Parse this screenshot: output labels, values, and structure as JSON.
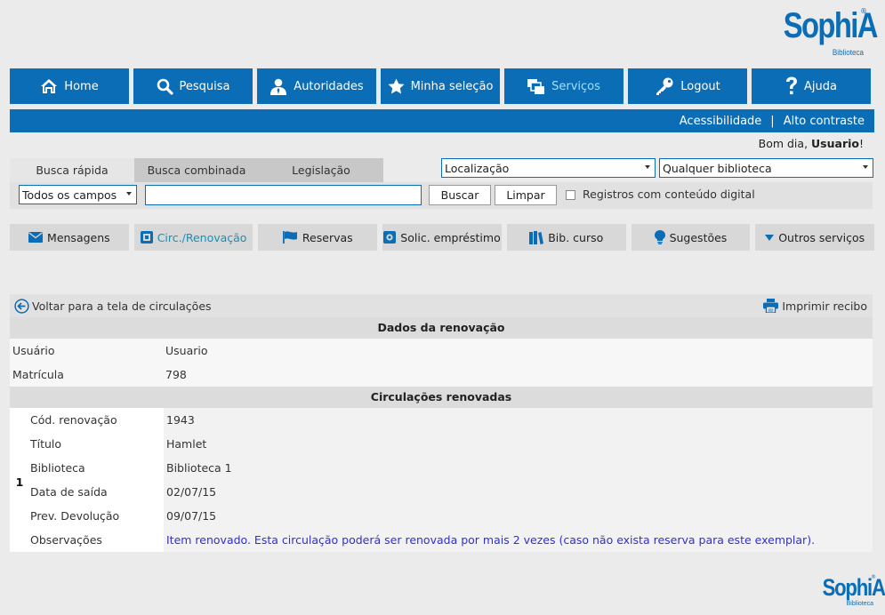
{
  "logo": {
    "word": "SophiA",
    "reg": "®",
    "sub": "Biblioteca"
  },
  "nav": [
    {
      "label": "Home",
      "icon": "home-icon"
    },
    {
      "label": "Pesquisa",
      "icon": "search-icon"
    },
    {
      "label": "Autoridades",
      "icon": "user-icon"
    },
    {
      "label": "Minha seleção",
      "icon": "star-icon"
    },
    {
      "label": "Serviços",
      "icon": "services-icon",
      "active": true
    },
    {
      "label": "Logout",
      "icon": "key-icon"
    },
    {
      "label": "Ajuda",
      "icon": "help-icon"
    }
  ],
  "accessibility": {
    "acc": "Acessibilidade",
    "sep": "|",
    "contrast": "Alto contraste"
  },
  "greeting": {
    "prefix": "Bom dia, ",
    "user": "Usuario",
    "suffix": "!"
  },
  "search": {
    "tabs": [
      "Busca rápida",
      "Busca combinada",
      "Legislação"
    ],
    "location": "Localização",
    "library": "Qualquer biblioteca",
    "field": "Todos os campos",
    "query": "",
    "buscar": "Buscar",
    "limpar": "Limpar",
    "digital": "Registros com conteúdo digital"
  },
  "services": [
    {
      "label": "Mensagens",
      "icon": "envelope-icon"
    },
    {
      "label": "Circ./Renovação",
      "icon": "renew-icon",
      "active": true
    },
    {
      "label": "Reservas",
      "icon": "flag-icon"
    },
    {
      "label": "Solic. empréstimo",
      "icon": "loan-icon"
    },
    {
      "label": "Bib. curso",
      "icon": "books-icon"
    },
    {
      "label": "Sugestões",
      "icon": "bulb-icon"
    },
    {
      "label": "Outros serviços",
      "icon": "caret-down-icon"
    }
  ],
  "content": {
    "back": "Voltar para a tela de circulações",
    "print": "Imprimir recibo",
    "renewal_header": "Dados da renovação",
    "user_label": "Usuário",
    "user_value": "Usuario",
    "reg_label": "Matrícula",
    "reg_value": "798",
    "circ_header": "Circulações renovadas",
    "item_number": "1",
    "fields": [
      {
        "k": "Cód. renovação",
        "v": "1943"
      },
      {
        "k": "Título",
        "v": "Hamlet"
      },
      {
        "k": "Biblioteca",
        "v": "Biblioteca 1"
      },
      {
        "k": "Data de saída",
        "v": "02/07/15"
      },
      {
        "k": "Prev. Devolução",
        "v": "09/07/15"
      },
      {
        "k": "Observações",
        "v": "Item renovado. Esta circulação poderá ser renovada por mais 2 vezes (caso não exista reserva para este exemplar)."
      }
    ]
  },
  "colors": {
    "brand": "#0b6db5",
    "active_text": "#9fe0ff",
    "note": "#2f2fd4"
  }
}
